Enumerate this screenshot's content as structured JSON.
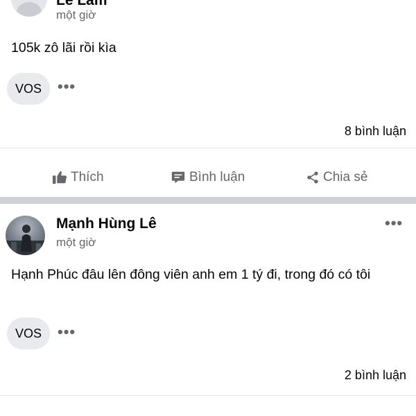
{
  "posts": [
    {
      "author": "Lê Lâm",
      "time": "một giờ",
      "text": "105k zô lãi rồi kìa",
      "group_tag": "VOS",
      "comment_count": "8 bình luận"
    },
    {
      "author": "Mạnh Hùng Lê",
      "time": "một giờ",
      "text": "Hạnh Phúc đâu lên đông viên anh em 1 tý đi, trong đó có tôi",
      "group_tag": "VOS",
      "comment_count": "2 bình luận"
    }
  ],
  "actions": {
    "like": "Thích",
    "comment": "Bình luận",
    "share": "Chia sẻ"
  },
  "icons": {
    "like": "thumbs-up-icon",
    "comment": "comment-icon",
    "share": "share-icon",
    "more": "more-options-icon"
  }
}
